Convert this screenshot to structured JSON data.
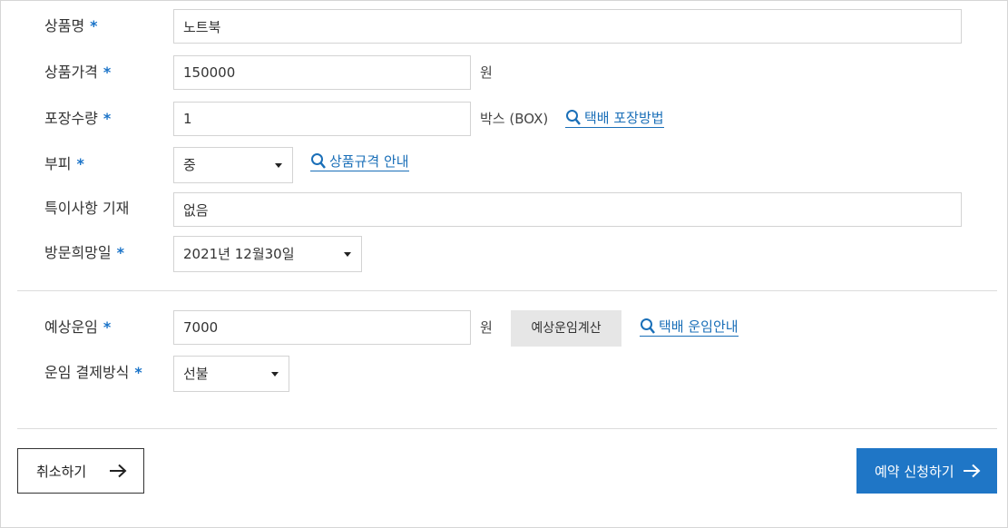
{
  "fields": {
    "product_name": {
      "label": "상품명",
      "required": "*",
      "value": "노트북"
    },
    "product_price": {
      "label": "상품가격",
      "required": "*",
      "value": "150000",
      "unit": "원"
    },
    "package_qty": {
      "label": "포장수량",
      "required": "*",
      "value": "1",
      "unit": "박스 (BOX)",
      "guide": "택배 포장방법"
    },
    "volume": {
      "label": "부피",
      "required": "*",
      "selected": "중",
      "guide": "상품규격 안내"
    },
    "notes": {
      "label": "특이사항 기재",
      "value": "없음"
    },
    "visit_date": {
      "label": "방문희망일",
      "required": "*",
      "selected": "2021년 12월30일"
    },
    "est_fee": {
      "label": "예상운임",
      "required": "*",
      "value": "7000",
      "unit": "원",
      "calc_button": "예상운임계산",
      "guide": "택배 운임안내"
    },
    "payment": {
      "label": "운임 결제방식",
      "required": "*",
      "selected": "선불"
    }
  },
  "buttons": {
    "cancel": "취소하기",
    "submit": "예약 신청하기"
  },
  "colors": {
    "accent": "#1f76c6",
    "link": "#1a6fb8",
    "required": "#1a73c8"
  }
}
